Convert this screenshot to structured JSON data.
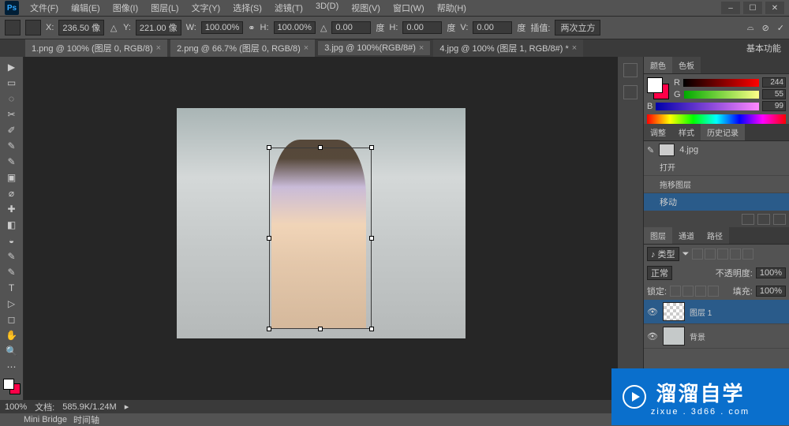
{
  "menu": [
    "文件(F)",
    "编辑(E)",
    "图像(I)",
    "图层(L)",
    "文字(Y)",
    "选择(S)",
    "滤镜(T)",
    "3D(D)",
    "视图(V)",
    "窗口(W)",
    "帮助(H)"
  ],
  "window_controls": [
    "–",
    "☐",
    "✕"
  ],
  "options": {
    "x_label": "X:",
    "x": "236.50 像",
    "y_label": "Y:",
    "y": "221.00 像",
    "w_label": "W:",
    "w": "100.00%",
    "h_label": "H:",
    "h": "100.00%",
    "angle_label": "△",
    "angle": "0.00",
    "angle_unit": "度",
    "skew_h_label": "H:",
    "skew_h": "0.00",
    "skew_h_unit": "度",
    "skew_v_label": "V:",
    "skew_v": "0.00",
    "skew_v_unit": "度",
    "interp_label": "插值:",
    "interp": "两次立方",
    "basic": "基本功能"
  },
  "tabs": [
    {
      "label": "1.png @ 100% (图层 0, RGB/8)",
      "active": false
    },
    {
      "label": "2.png @ 66.7% (图层 0, RGB/8)",
      "active": false
    },
    {
      "label": "3.jpg @ 100%(RGB/8#)",
      "active": false
    },
    {
      "label": "4.jpg @ 100% (图层 1, RGB/8#) *",
      "active": true
    }
  ],
  "tools": [
    "▶",
    "▭",
    "◌",
    "✂",
    "✐",
    "✎",
    "✎",
    "▣",
    "⌀",
    "✚",
    "◧",
    "◒",
    "✎",
    "✎",
    "T",
    "▷",
    "◻",
    "✋",
    "🔍",
    "⋯"
  ],
  "panel_color": {
    "tabs": [
      "颜色",
      "色板"
    ],
    "r_label": "R",
    "g_label": "G",
    "b_label": "B",
    "r": "244",
    "g": "55",
    "b": "99"
  },
  "panel_history": {
    "tabs": [
      "调整",
      "样式",
      "历史记录"
    ],
    "thumb_label": "4.jpg",
    "items": [
      "打开",
      "拖移图层",
      "移动"
    ]
  },
  "panel_layers": {
    "tabs": [
      "图层",
      "通道",
      "路径"
    ],
    "type_label": "♪ 类型",
    "blend": "正常",
    "opacity_label": "不透明度:",
    "opacity": "100%",
    "lock_label": "锁定:",
    "fill_label": "填充:",
    "fill": "100%",
    "layers": [
      {
        "name": "图层 1",
        "active": true
      },
      {
        "name": "背景",
        "active": false
      }
    ]
  },
  "status": {
    "zoom": "100%",
    "doc_label": "文档:",
    "doc": "585.9K/1.24M"
  },
  "bottom_tabs": [
    "Mini Bridge",
    "时间轴"
  ],
  "watermark": {
    "title": "溜溜自学",
    "sub": "zixue . 3d66 . com"
  }
}
